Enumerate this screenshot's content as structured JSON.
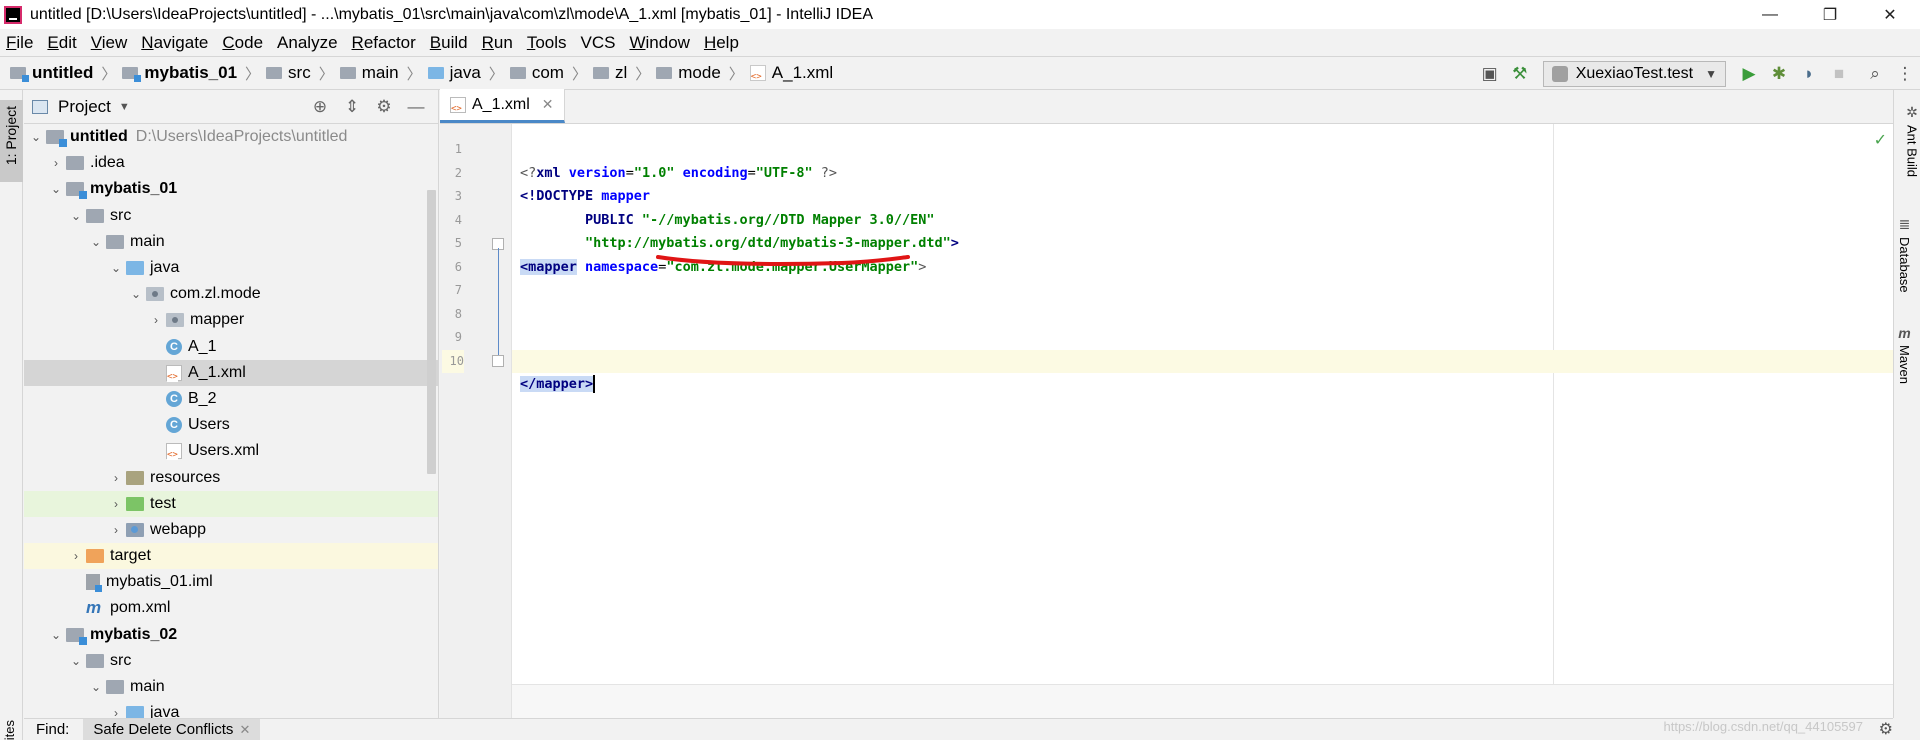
{
  "window": {
    "title": "untitled [D:\\Users\\IdeaProjects\\untitled] - ...\\mybatis_01\\src\\main\\java\\com\\zl\\mode\\A_1.xml [mybatis_01] - IntelliJ IDEA",
    "minimize": "—",
    "restore": "❐",
    "close": "✕"
  },
  "menu": [
    {
      "u": "F",
      "rest": "ile"
    },
    {
      "u": "E",
      "rest": "dit"
    },
    {
      "u": "V",
      "rest": "iew"
    },
    {
      "u": "N",
      "rest": "avigate"
    },
    {
      "u": "C",
      "rest": "ode"
    },
    {
      "u": "",
      "rest": "Analyze"
    },
    {
      "u": "R",
      "rest": "efactor"
    },
    {
      "u": "B",
      "rest": "uild"
    },
    {
      "u": "R",
      "rest": "un"
    },
    {
      "u": "T",
      "rest": "ools"
    },
    {
      "u": "",
      "rest": "VCS"
    },
    {
      "u": "W",
      "rest": "indow"
    },
    {
      "u": "H",
      "rest": "elp"
    }
  ],
  "breadcrumbs": [
    "untitled",
    "mybatis_01",
    "src",
    "main",
    "java",
    "com",
    "zl",
    "mode",
    "A_1.xml"
  ],
  "run_config": "XuexiaoTest.test",
  "left_strip": {
    "project_tab": "1: Project",
    "bottom_tab": "ites"
  },
  "project_panel": {
    "title": "Project",
    "tree": [
      {
        "label": "untitled",
        "hint": "D:\\Users\\IdeaProjects\\untitled"
      },
      {
        "label": ".idea"
      },
      {
        "label": "mybatis_01"
      },
      {
        "label": "src"
      },
      {
        "label": "main"
      },
      {
        "label": "java"
      },
      {
        "label": "com.zl.mode"
      },
      {
        "label": "mapper"
      },
      {
        "label": "A_1"
      },
      {
        "label": "A_1.xml"
      },
      {
        "label": "B_2"
      },
      {
        "label": "Users"
      },
      {
        "label": "Users.xml"
      },
      {
        "label": "resources"
      },
      {
        "label": "test"
      },
      {
        "label": "webapp"
      },
      {
        "label": "target"
      },
      {
        "label": "mybatis_01.iml"
      },
      {
        "label": "pom.xml"
      },
      {
        "label": "mybatis_02"
      },
      {
        "label": "src"
      },
      {
        "label": "main"
      },
      {
        "label": "java"
      }
    ]
  },
  "editor": {
    "tab_label": "A_1.xml",
    "line_numbers": [
      "1",
      "2",
      "3",
      "4",
      "5",
      "6",
      "7",
      "8",
      "9",
      "10"
    ],
    "code": {
      "l1a": "<?",
      "l1b": "xml ",
      "l1c": "version",
      "l1d": "=",
      "l1e": "\"1.0\"",
      "l1f": " encoding",
      "l1g": "=",
      "l1h": "\"UTF-8\"",
      "l1i": " ?>",
      "l2a": "<!DOCTYPE ",
      "l2b": "mapper",
      "l3a": "        PUBLIC ",
      "l3b": "\"-//mybatis.org//DTD Mapper 3.0//EN\"",
      "l4a": "        ",
      "l4b": "\"http://mybatis.org/dtd/mybatis-3-mapper.dtd\"",
      "l4c": ">",
      "l5a": "<mapper",
      "l5b": " namespace",
      "l5c": "=",
      "l5d": "\"com.zl.mode.mapper.UserMapper\"",
      "l5e": ">",
      "l10a": "</mapper>"
    }
  },
  "right_strip": {
    "ant": "Ant Build",
    "database": "Database",
    "maven": "Maven"
  },
  "bottom": {
    "find_label": "Find:",
    "tab_label": "Safe Delete Conflicts",
    "watermark": "https://blog.csdn.net/qq_44105597"
  }
}
